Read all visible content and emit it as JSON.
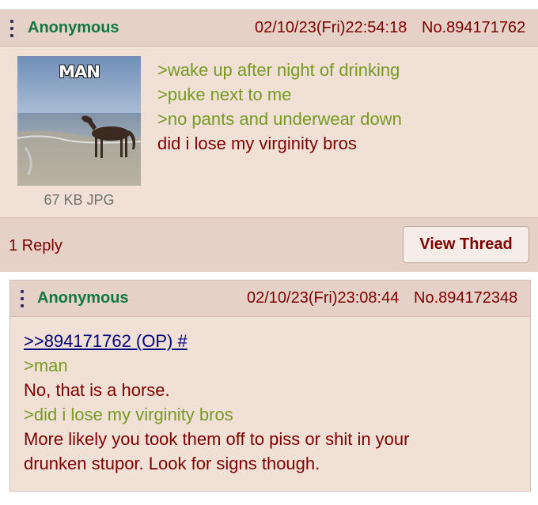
{
  "op": {
    "name": "Anonymous",
    "datetime": "02/10/23(Fri)22:54:18",
    "post_no": "No.894171762",
    "image_caption": "MAN",
    "file_info": "67 KB JPG",
    "lines": [
      {
        "text": ">wake up after night of drinking",
        "kind": "quote"
      },
      {
        "text": ">puke next to me",
        "kind": "quote"
      },
      {
        "text": ">no pants and underwear down",
        "kind": "quote"
      },
      {
        "text": "did i lose my virginity bros",
        "kind": "plain"
      }
    ],
    "replies_label": "1 Reply",
    "view_thread_label": "View Thread"
  },
  "reply": {
    "name": "Anonymous",
    "datetime": "02/10/23(Fri)23:08:44",
    "post_no": "No.894172348",
    "quote_link": ">>894171762 (OP) #",
    "lines": [
      {
        "text": ">man",
        "kind": "quote"
      },
      {
        "text": "No, that is a horse.",
        "kind": "plain"
      },
      {
        "text": ">did i lose my virginity bros",
        "kind": "quote"
      },
      {
        "text": "More likely you took them off to piss or shit in your",
        "kind": "plain"
      },
      {
        "text": "drunken stupor. Look for signs though.",
        "kind": "plain"
      }
    ]
  },
  "colors": {
    "post_bg": "#f0e0d6",
    "header_bg": "#e5d1c8",
    "name": "#117743",
    "greentext": "#789922",
    "text": "#800000",
    "link": "#000080"
  },
  "icons": [
    "menu-dots-icon"
  ]
}
